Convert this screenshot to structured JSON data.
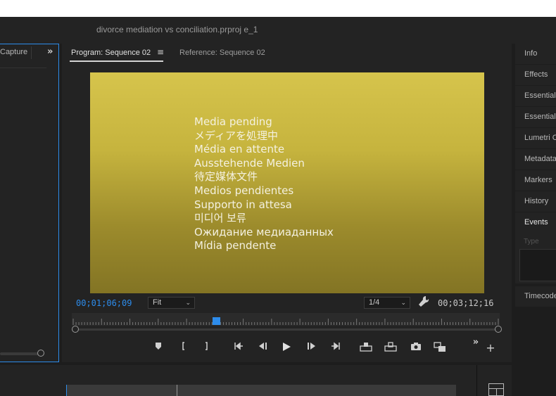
{
  "window": {
    "title": "divorce mediation vs conciliation.prproj e_1"
  },
  "left_panel": {
    "tab_label": "Capture",
    "overflow_icon": "double-chevron-right-icon"
  },
  "program_monitor": {
    "tab_active": "Program: Sequence 02",
    "tab_menu_icon": "hamburger-menu-icon",
    "tab_inactive": "Reference: Sequence 02",
    "media_pending_lines": [
      "Media pending",
      "メディアを処理中",
      "Média en attente",
      "Ausstehende Medien",
      "待定媒体文件",
      "Medios pendientes",
      "Supporto in attesa",
      "미디어 보류",
      "Ожидание медиаданных",
      "Mídia pendente"
    ],
    "timecode_current": "00;01;06;09",
    "zoom_select": "Fit",
    "quality_select": "1/4",
    "timecode_duration": "00;03;12;16",
    "playhead_fraction": 0.34,
    "transport_buttons": [
      "add-marker-icon",
      "mark-in-icon",
      "mark-out-icon",
      "go-to-in-icon",
      "step-back-icon",
      "play-icon",
      "step-forward-icon",
      "go-to-out-icon",
      "lift-icon",
      "extract-icon",
      "export-frame-icon",
      "comparison-view-icon",
      "more-icon",
      "add-button-icon"
    ]
  },
  "right_panel": {
    "items": [
      "Info",
      "Effects",
      "Essential",
      "Essential",
      "Lumetri C",
      "Metadata",
      "Markers",
      "History",
      "Events",
      "Timecode"
    ],
    "events_type_label": "Type"
  },
  "colors": {
    "accent": "#2d8ceb",
    "video_top": "#d6c44c",
    "video_bottom": "#837424"
  }
}
